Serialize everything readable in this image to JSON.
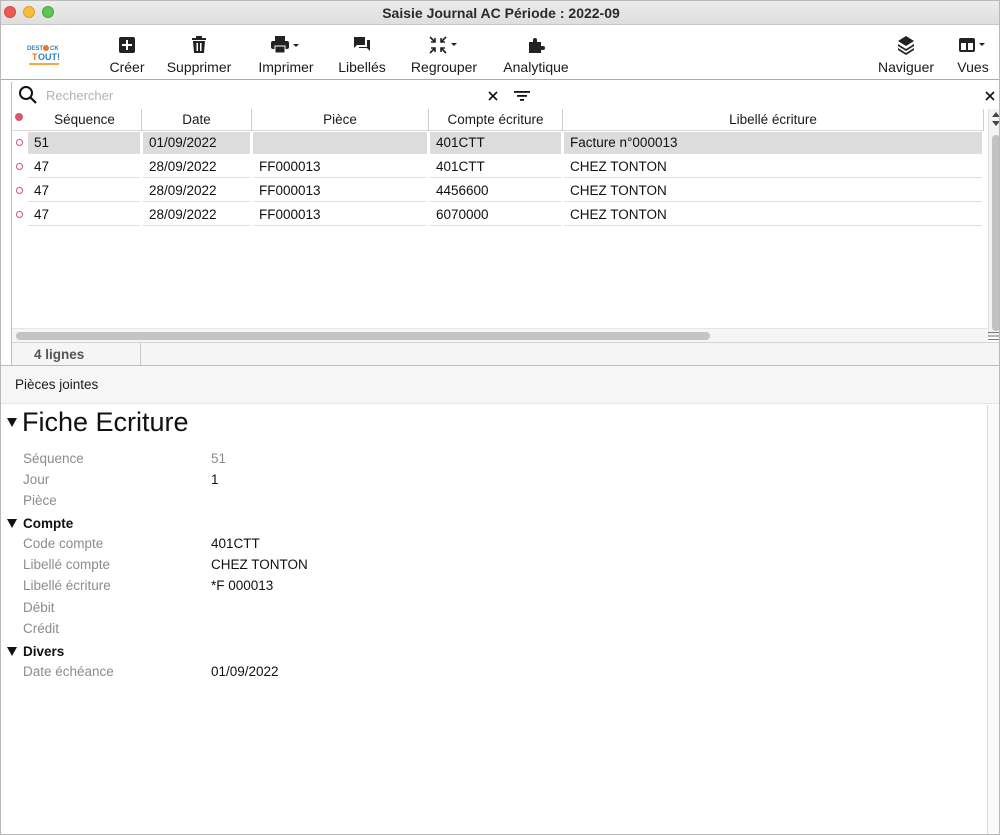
{
  "window": {
    "title": "Saisie Journal AC Période : 2022-09"
  },
  "toolbar": {
    "logo_text": "DESTOCK TOUT!",
    "creer": "Créer",
    "supprimer": "Supprimer",
    "imprimer": "Imprimer",
    "libelles": "Libellés",
    "regrouper": "Regrouper",
    "analytique": "Analytique",
    "naviguer": "Naviguer",
    "vues": "Vues"
  },
  "search": {
    "placeholder": "Rechercher",
    "value": ""
  },
  "table": {
    "columns": [
      "Séquence",
      "Date",
      "Pièce",
      "Compte écriture",
      "Libellé écriture"
    ],
    "rows": [
      [
        "51",
        "01/09/2022",
        "",
        "401CTT",
        "Facture n°000013"
      ],
      [
        "47",
        "28/09/2022",
        "FF000013",
        "401CTT",
        "CHEZ TONTON"
      ],
      [
        "47",
        "28/09/2022",
        "FF000013",
        "4456600",
        "CHEZ TONTON"
      ],
      [
        "47",
        "28/09/2022",
        "FF000013",
        "6070000",
        "CHEZ TONTON"
      ]
    ],
    "selected_row": 0,
    "status_count": "4 lignes"
  },
  "attachments": {
    "label": "Pièces jointes"
  },
  "fiche": {
    "title": "Fiche Ecriture",
    "sequence_label": "Séquence",
    "sequence_value": "51",
    "jour_label": "Jour",
    "jour_value": "1",
    "piece_label": "Pièce",
    "compte_section": "Compte",
    "code_compte_label": "Code compte",
    "code_compte_value": "401CTT",
    "libelle_compte_label": "Libellé compte",
    "libelle_compte_value": "CHEZ TONTON",
    "libelle_ecriture_label": "Libellé écriture",
    "libelle_ecriture_value": "*F 000013",
    "debit_label": "Débit",
    "credit_label": "Crédit",
    "divers_section": "Divers",
    "date_echeance_label": "Date échéance",
    "date_echeance_value": "01/09/2022"
  }
}
